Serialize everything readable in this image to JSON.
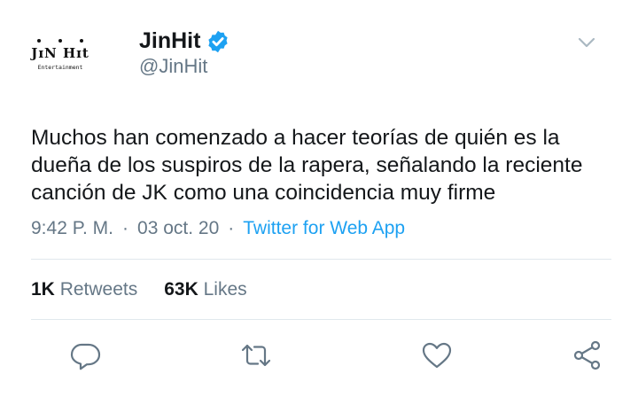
{
  "user": {
    "avatar_logo": "JɪN Hɪt",
    "avatar_sub": "Entertainment",
    "display_name": "JinHit",
    "handle": "@JinHit"
  },
  "tweet": {
    "text": "Muchos han comenzado a hacer teorías de quién es la dueña de los suspiros de la rapera, señalando la reciente canción de JK como una coincidencia muy firme",
    "time": "9:42 P. M.",
    "separator": "·",
    "date": "03 oct. 20",
    "source": "Twitter for Web App"
  },
  "stats": {
    "retweets_count": "1K",
    "retweets_label": "Retweets",
    "likes_count": "63K",
    "likes_label": "Likes"
  },
  "icons": {
    "verified": "verified-badge-icon",
    "caret": "chevron-down-icon",
    "reply": "reply-icon",
    "retweet": "retweet-icon",
    "like": "heart-icon",
    "share": "share-icon"
  },
  "colors": {
    "accent": "#1da1f2",
    "secondary_text": "#657786",
    "primary_text": "#14171a",
    "divider": "#e1e8ed"
  }
}
